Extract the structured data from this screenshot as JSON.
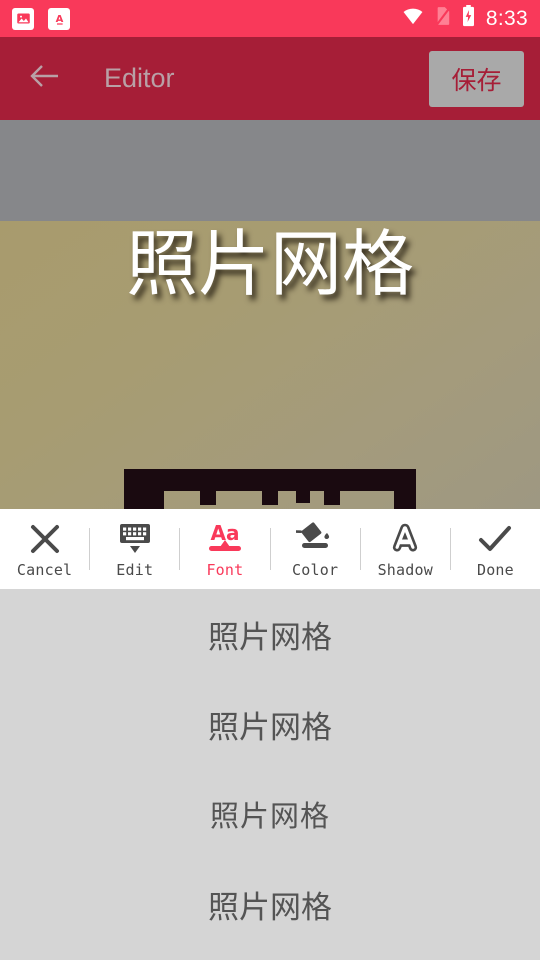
{
  "statusbar": {
    "time": "8:33",
    "left_icons": [
      {
        "name": "gallery-notification-icon",
        "glyph": "image"
      },
      {
        "name": "app-a-notification-icon",
        "glyph": "A"
      }
    ],
    "right_icons": [
      {
        "name": "wifi-icon"
      },
      {
        "name": "no-sim-card-icon"
      },
      {
        "name": "battery-charging-icon"
      }
    ]
  },
  "appbar": {
    "back_label": "back",
    "title": "Editor",
    "save_label": "保存",
    "bg_color": "#a61e37",
    "title_color": "#b9a0a6",
    "save_bg_color": "#a9a9a9"
  },
  "canvas": {
    "overlay_text": "照片网格",
    "overlay_text_color": "#ffffff",
    "photo_bg_color": "#a89b6d",
    "band_color": "#86878a",
    "frame_color": "#1a0a10"
  },
  "toolbar": {
    "accent_color": "#f9395a",
    "items": [
      {
        "name": "cancel",
        "label": "Cancel",
        "icon": "close-icon",
        "active": false
      },
      {
        "name": "edit",
        "label": "Edit",
        "icon": "keyboard-hide-icon",
        "active": false
      },
      {
        "name": "font",
        "label": "Font",
        "icon": "font-aa-icon",
        "active": true
      },
      {
        "name": "color",
        "label": "Color",
        "icon": "paint-bucket-icon",
        "active": false
      },
      {
        "name": "shadow",
        "label": "Shadow",
        "icon": "letter-a-outline-icon",
        "active": false
      },
      {
        "name": "done",
        "label": "Done",
        "icon": "check-icon",
        "active": false
      }
    ]
  },
  "font_list": {
    "bg_color": "#d5d5d5",
    "text_color": "#545454",
    "rows": [
      {
        "sample": "照片网格"
      },
      {
        "sample": "照片网格"
      },
      {
        "sample": "照片网格"
      },
      {
        "sample": "照片网格"
      }
    ]
  }
}
